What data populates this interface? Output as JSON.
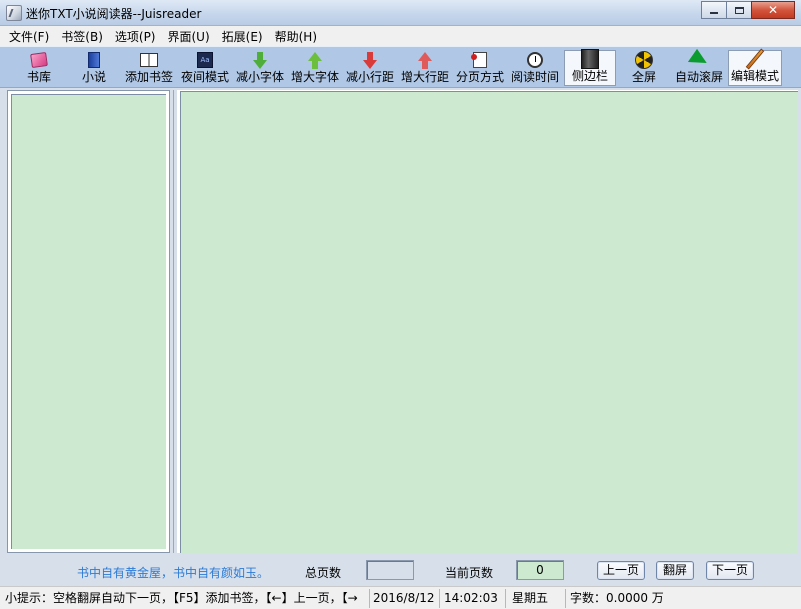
{
  "window": {
    "title": "迷你TXT小说阅读器--Juisreader",
    "close_glyph": "✕"
  },
  "menu": [
    {
      "label": "文件(F)"
    },
    {
      "label": "书签(B)"
    },
    {
      "label": "选项(P)"
    },
    {
      "label": "界面(U)"
    },
    {
      "label": "拓展(E)"
    },
    {
      "label": "帮助(H)"
    }
  ],
  "toolbar": [
    {
      "label": "书库",
      "icon": "library-icon"
    },
    {
      "label": "小说",
      "icon": "novel-icon"
    },
    {
      "label": "添加书签",
      "icon": "add-bookmark-icon"
    },
    {
      "label": "夜间模式",
      "icon": "night-mode-icon"
    },
    {
      "label": "减小字体",
      "icon": "arrow-down-icon",
      "color": "#4fae3a"
    },
    {
      "label": "增大字体",
      "icon": "arrow-up-icon",
      "color": "#6cbf3c"
    },
    {
      "label": "减小行距",
      "icon": "arrow-down-icon",
      "color": "#d93a3a"
    },
    {
      "label": "增大行距",
      "icon": "arrow-up-icon",
      "color": "#e05a5a"
    },
    {
      "label": "分页方式",
      "icon": "page-mode-icon"
    },
    {
      "label": "阅读时间",
      "icon": "clock-icon"
    },
    {
      "label": "侧边栏",
      "icon": "sidebar-icon",
      "pressed": true
    },
    {
      "label": "全屏",
      "icon": "fullscreen-icon"
    },
    {
      "label": "自动滚屏",
      "icon": "auto-scroll-icon"
    },
    {
      "label": "编辑模式",
      "icon": "edit-mode-icon",
      "pressed": true
    }
  ],
  "reader": {
    "background_color": "#cde9d0"
  },
  "navbar": {
    "motto": "书中自有黄金屋，书中自有颜如玉。",
    "total_pages_label": "总页数",
    "total_pages_value": "",
    "current_page_label": "当前页数",
    "current_page_value": "0",
    "prev_page": "上一页",
    "flip_screen": "翻屏",
    "next_page": "下一页"
  },
  "statusbar": {
    "hint": "小提示：空格翻屏自动下一页，【F5】添加书签，【←】上一页，【→",
    "date": "2016/8/12",
    "time": "14:02:03",
    "weekday": "星期五",
    "word_count": "字数：0.0000 万"
  }
}
